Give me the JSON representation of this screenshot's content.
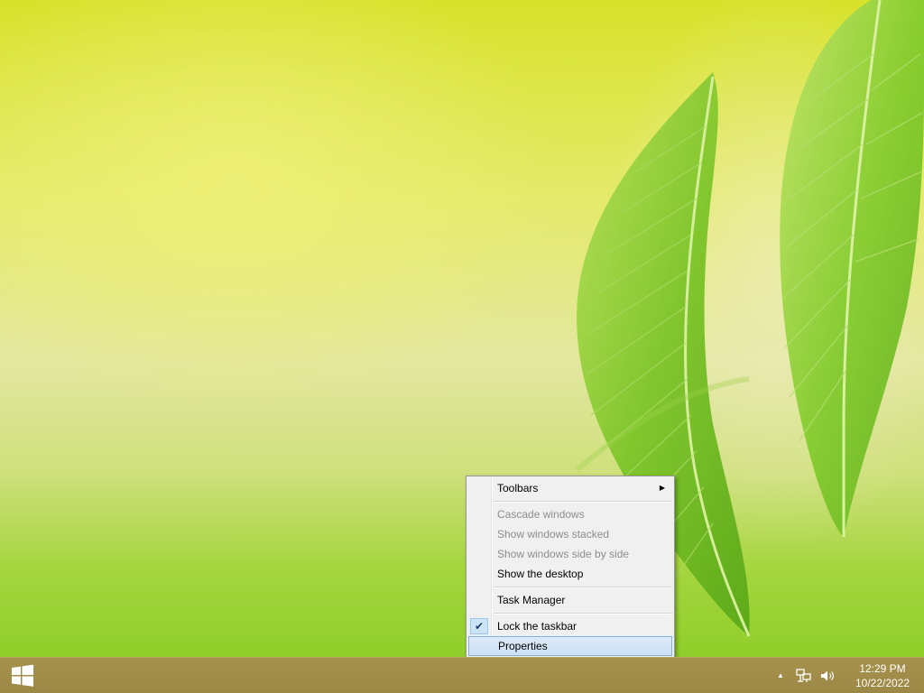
{
  "context_menu": {
    "items": [
      {
        "label": "Toolbars",
        "disabled": false,
        "submenu": true
      },
      {
        "label": "Cascade windows",
        "disabled": true
      },
      {
        "label": "Show windows stacked",
        "disabled": true
      },
      {
        "label": "Show windows side by side",
        "disabled": true
      },
      {
        "label": "Show the desktop",
        "disabled": false
      },
      {
        "label": "Task Manager",
        "disabled": false
      },
      {
        "label": "Lock the taskbar",
        "disabled": false,
        "checked": true
      },
      {
        "label": "Properties",
        "disabled": false,
        "highlighted": true
      }
    ],
    "submenu_arrow": "▶",
    "check_glyph": "✔"
  },
  "taskbar": {
    "start_icon": "windows-logo-icon",
    "tray_icons": [
      "show-hidden-icons-arrow",
      "network-icon",
      "volume-icon"
    ],
    "tray_arrow_glyph": "▲",
    "clock": {
      "time": "12:29 PM",
      "date": "10/22/2022"
    }
  },
  "colors": {
    "taskbar": "#a7914d",
    "menu_bg": "#f0f0f0",
    "menu_highlight": "#cce1f5",
    "menu_highlight_border": "#7fb1e3",
    "disabled_text": "#8d8d8d"
  }
}
